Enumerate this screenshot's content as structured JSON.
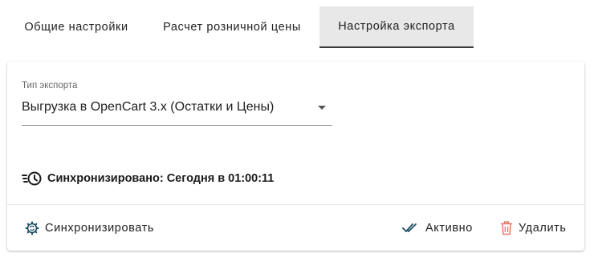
{
  "tabs": [
    {
      "label": "Общие настройки"
    },
    {
      "label": "Расчет розничной цены"
    },
    {
      "label": "Настройка экспорта"
    }
  ],
  "export": {
    "field_label": "Тип экспорта",
    "selected_value": "Выгрузка в OpenCart 3.x (Остатки и Цены)"
  },
  "sync_status": {
    "text": "Синхронизировано: Сегодня в 01:00:11",
    "icon": "history-icon"
  },
  "actions": {
    "sync_label": "Синхронизировать",
    "active_label": "Активно",
    "delete_label": "Удалить"
  },
  "colors": {
    "icon_blue": "#1d4e66",
    "delete_icon": "#e07a6a",
    "active_tab_bg": "#e8e8e8"
  }
}
